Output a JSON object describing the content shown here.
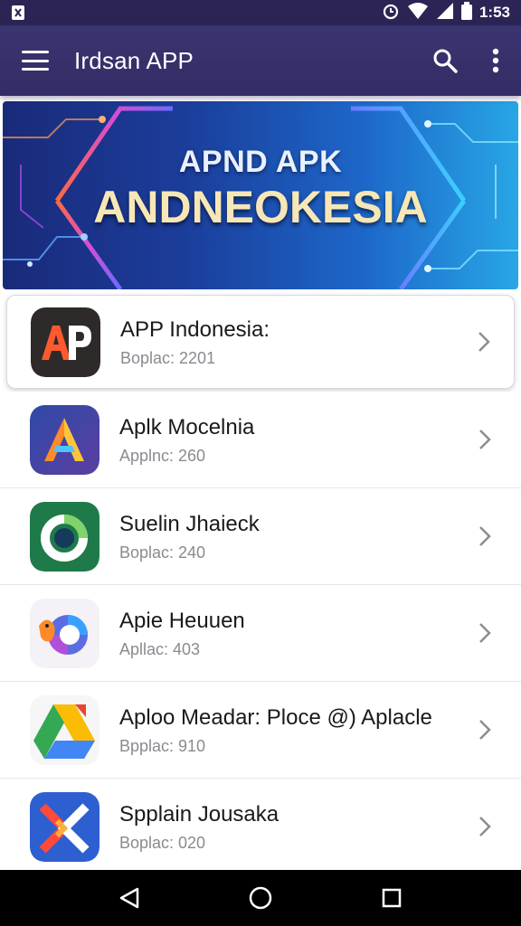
{
  "status_bar": {
    "time": "1:53"
  },
  "app_bar": {
    "title": "Irdsan APP"
  },
  "banner": {
    "line1": "APND APK",
    "line2": "ANDNEOKESIA"
  },
  "apps": [
    {
      "name": "APP Indonesia:",
      "subtitle": "Boplac: 2201",
      "icon": "ap-letters-icon"
    },
    {
      "name": "Aplk Mocelnia",
      "subtitle": "Applnc: 260",
      "icon": "letter-a-icon"
    },
    {
      "name": "Suelin Jhaieck",
      "subtitle": "Boplac: 240",
      "icon": "ring-icon"
    },
    {
      "name": "Apie Heuuen",
      "subtitle": "Apllac: 403",
      "icon": "bird-icon"
    },
    {
      "name": "Aploo Meadar: Ploce @) Aplacle",
      "subtitle": "Bpplac: 910",
      "icon": "drive-icon"
    },
    {
      "name": "Spplain Jousaka",
      "subtitle": "Boplac: 020",
      "icon": "x-mark-icon"
    }
  ],
  "colors": {
    "app_bar": "#3a3470",
    "status_bar": "#2b2455",
    "nav_bar": "#000000"
  }
}
